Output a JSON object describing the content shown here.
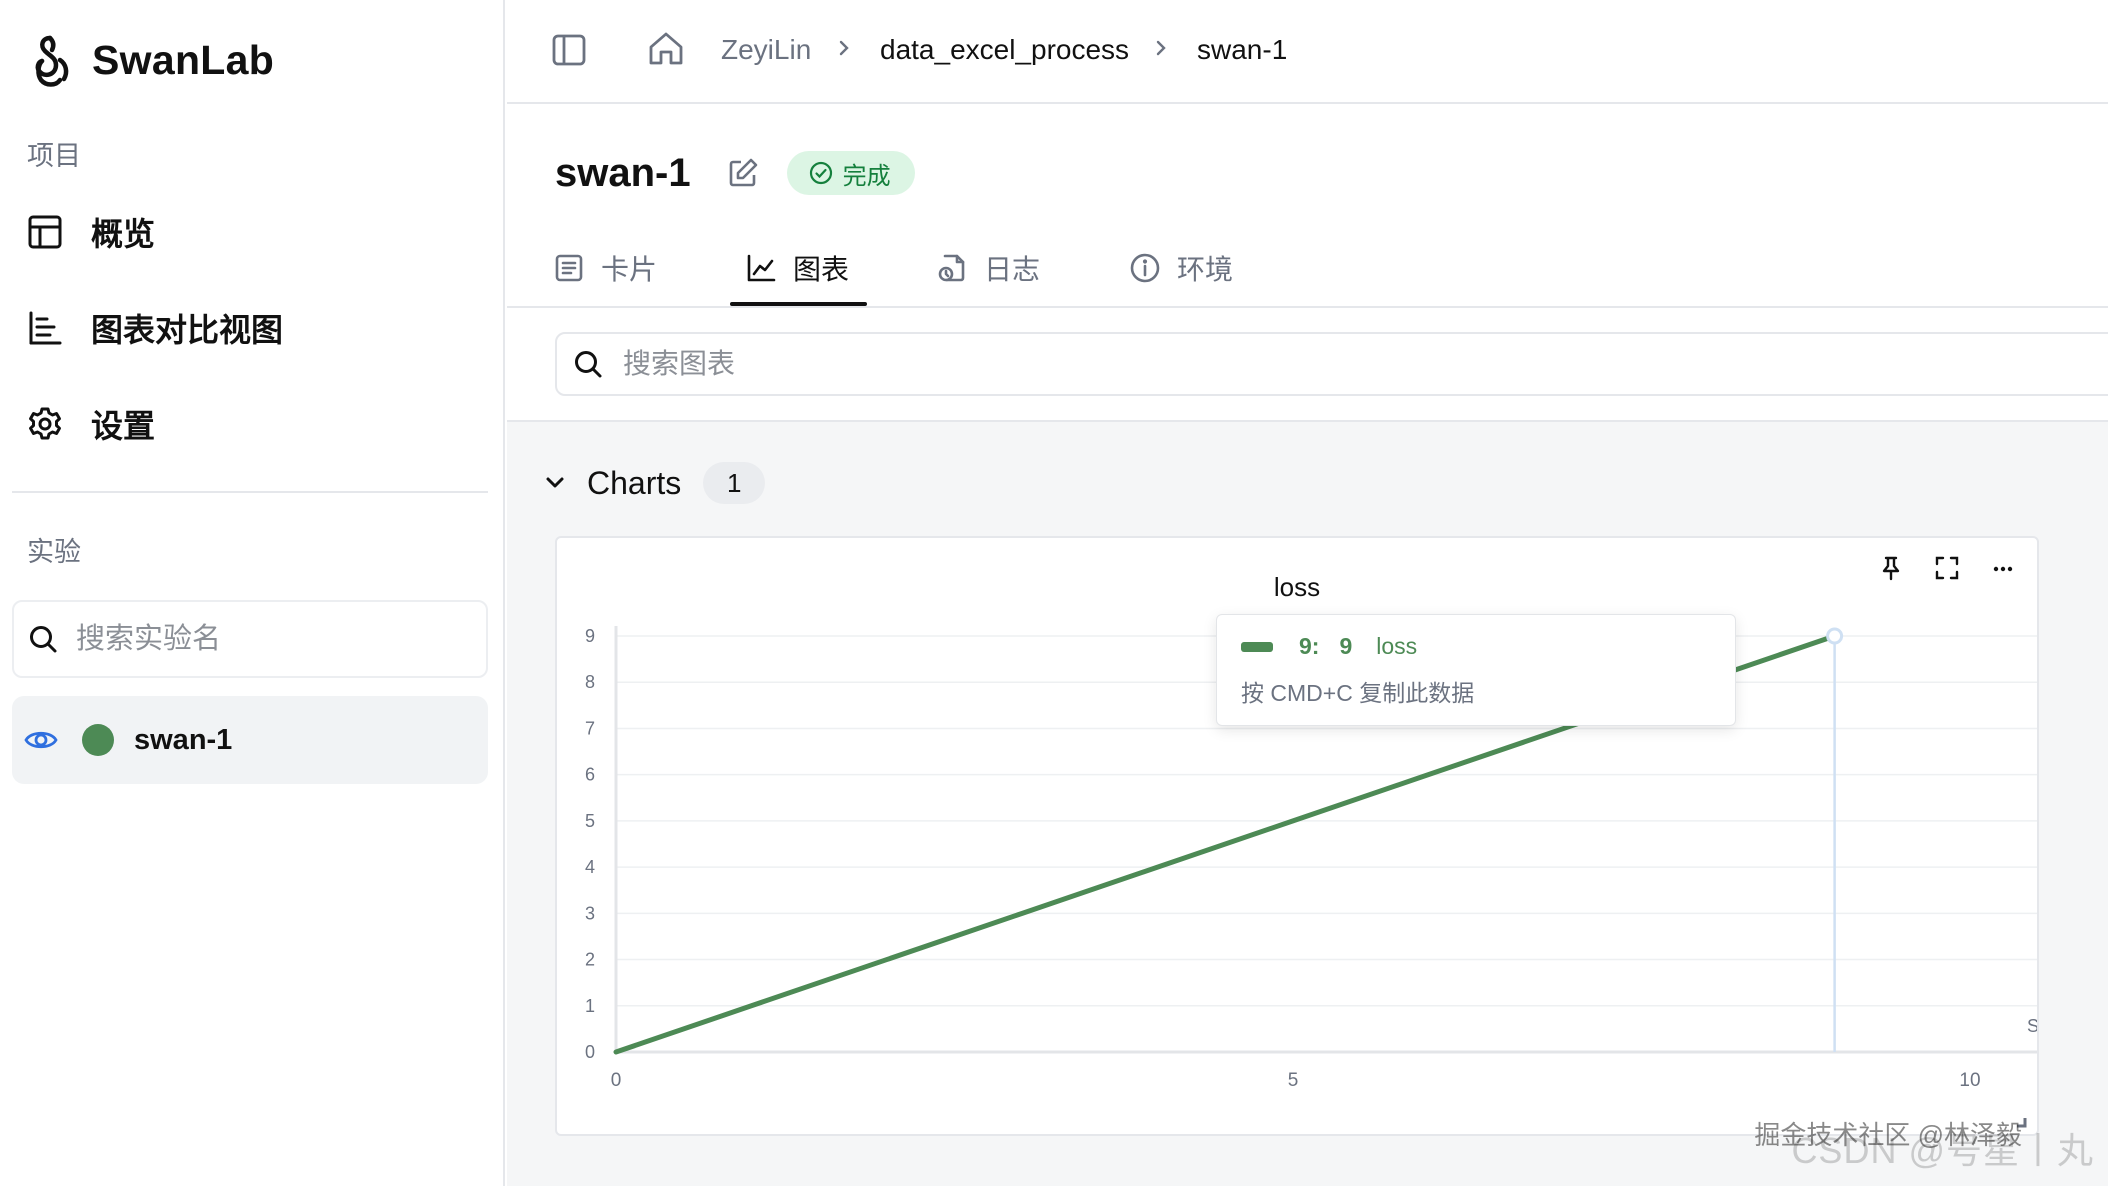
{
  "app": {
    "brand": "SwanLab"
  },
  "sidebar": {
    "project_label": "项目",
    "nav": [
      {
        "label": "概览",
        "icon": "table-icon"
      },
      {
        "label": "图表对比视图",
        "icon": "bar-chart-icon"
      },
      {
        "label": "设置",
        "icon": "gear-icon"
      }
    ],
    "experiments_label": "实验",
    "search_placeholder": "搜索实验名",
    "experiments": [
      {
        "name": "swan-1",
        "color": "#4d8a55",
        "visible": true
      }
    ]
  },
  "breadcrumb": {
    "items": [
      "ZeyiLin",
      "data_excel_process",
      "swan-1"
    ]
  },
  "run": {
    "title": "swan-1",
    "status": "完成",
    "status_color": "#15803d"
  },
  "tabs": [
    {
      "label": "卡片",
      "icon": "card-icon",
      "active": false
    },
    {
      "label": "图表",
      "icon": "line-chart-icon",
      "active": true
    },
    {
      "label": "日志",
      "icon": "log-icon",
      "active": false
    },
    {
      "label": "环境",
      "icon": "info-icon",
      "active": false
    }
  ],
  "chart_search": {
    "placeholder": "搜索图表"
  },
  "chart_group": {
    "title": "Charts",
    "count": "1"
  },
  "chart_data": {
    "type": "line",
    "title": "loss",
    "xlabel": "Step",
    "ylabel": "",
    "xlim": [
      0,
      10
    ],
    "ylim": [
      0,
      9
    ],
    "xticks": [
      0,
      5,
      10
    ],
    "yticks": [
      0,
      1,
      2,
      3,
      4,
      5,
      6,
      7,
      8,
      9
    ],
    "grid": true,
    "series": [
      {
        "name": "loss",
        "color": "#4d8a55",
        "x": [
          0,
          1,
          2,
          3,
          4,
          5,
          6,
          7,
          8,
          9
        ],
        "y": [
          0,
          1,
          2,
          3,
          4,
          5,
          6,
          7,
          8,
          9
        ]
      }
    ],
    "hover": {
      "step": 9,
      "value": 9
    }
  },
  "tooltip": {
    "step": "9:",
    "value": "9",
    "series": "loss",
    "hint": "按 CMD+C 复制此数据"
  },
  "watermark": {
    "text": "掘金技术社区 @林泽毅",
    "text2": "CSDN @号星丨丸"
  }
}
